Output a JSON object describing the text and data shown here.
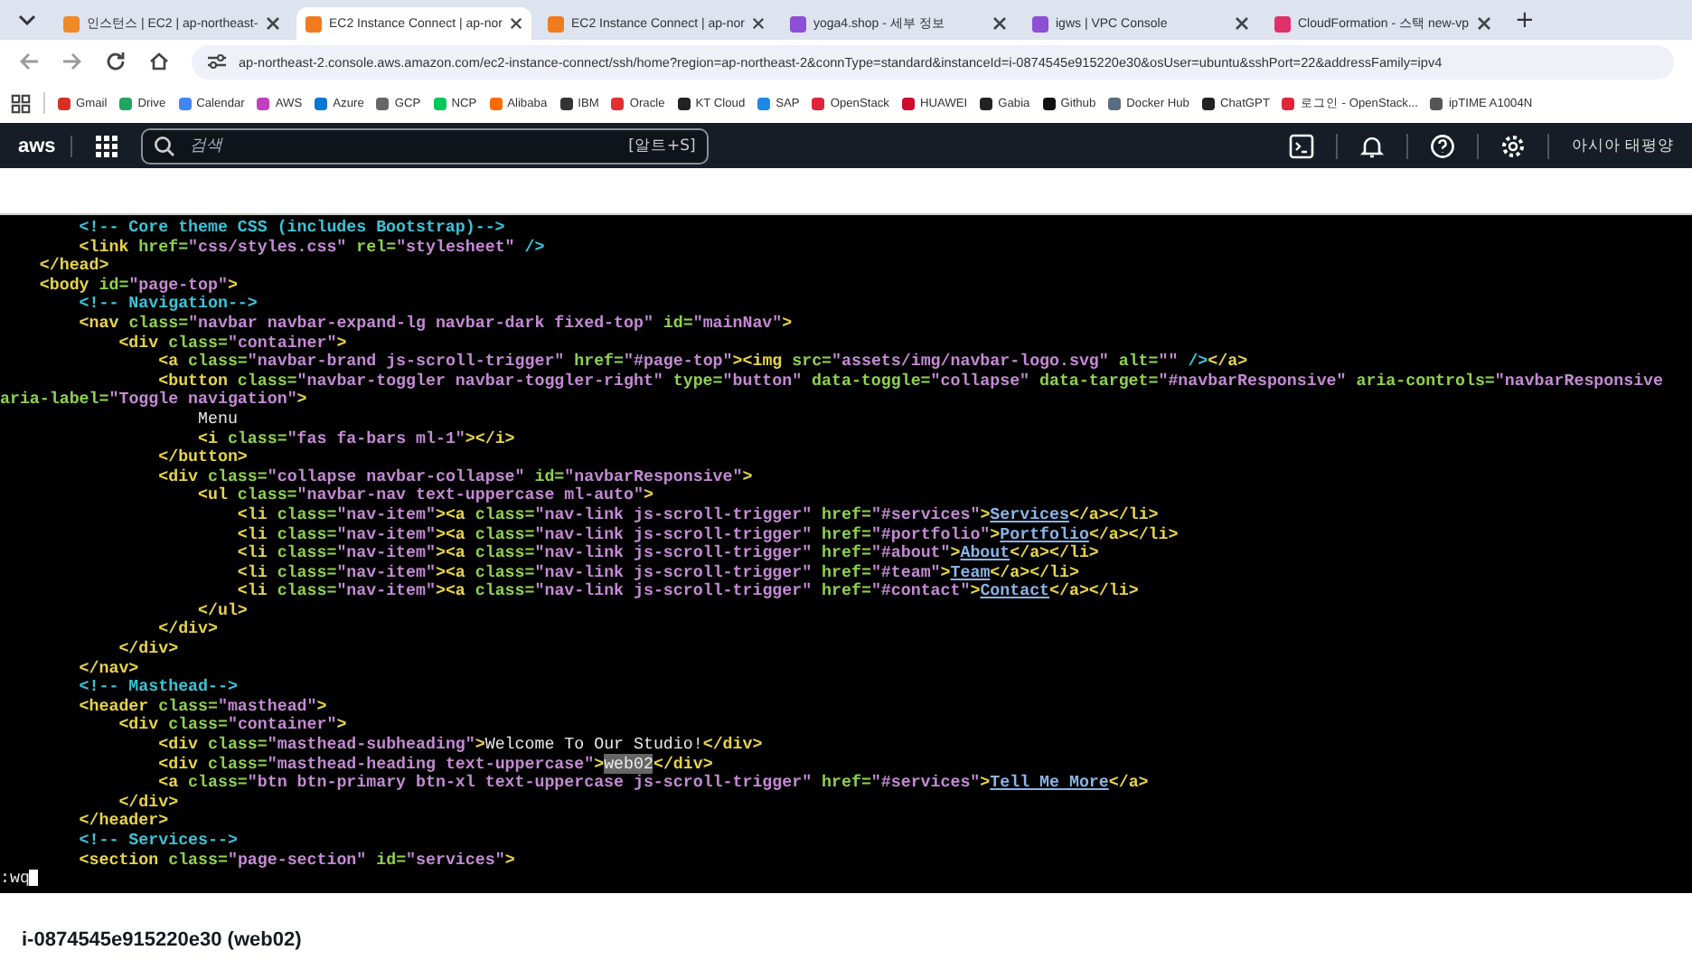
{
  "browser": {
    "tabs": [
      {
        "title": "인스턴스 | EC2 | ap-northeast-",
        "selected": false,
        "color": "#f08a24"
      },
      {
        "title": "EC2 Instance Connect | ap-nor",
        "selected": true,
        "color": "#f07b1e"
      },
      {
        "title": "EC2 Instance Connect | ap-nor",
        "selected": false,
        "color": "#f07b1e"
      },
      {
        "title": "yoga4.shop - 세부 정보",
        "selected": false,
        "color": "#8c4fd6"
      },
      {
        "title": "igws | VPC Console",
        "selected": false,
        "color": "#8c4fd6"
      },
      {
        "title": "CloudFormation - 스택 new-vp",
        "selected": false,
        "color": "#e0306a"
      }
    ],
    "new_tab": "+",
    "url": "ap-northeast-2.console.aws.amazon.com/ec2-instance-connect/ssh/home?region=ap-northeast-2&connType=standard&instanceId=i-0874545e915220e30&osUser=ubuntu&sshPort=22&addressFamily=ipv4",
    "bookmarks": [
      {
        "label": "Gmail",
        "color": "#d93025"
      },
      {
        "label": "Drive",
        "color": "#1fa463"
      },
      {
        "label": "Calendar",
        "color": "#4285f4"
      },
      {
        "label": "AWS",
        "color": "#c040c0"
      },
      {
        "label": "Azure",
        "color": "#0078d4"
      },
      {
        "label": "GCP",
        "color": "#666666"
      },
      {
        "label": "NCP",
        "color": "#03c75a"
      },
      {
        "label": "Alibaba",
        "color": "#ff6a00"
      },
      {
        "label": "IBM",
        "color": "#333333"
      },
      {
        "label": "Oracle",
        "color": "#e03030"
      },
      {
        "label": "KT Cloud",
        "color": "#222222"
      },
      {
        "label": "SAP",
        "color": "#1e88e5"
      },
      {
        "label": "OpenStack",
        "color": "#e0263a"
      },
      {
        "label": "HUAWEI",
        "color": "#cf0a2c"
      },
      {
        "label": "Gabia",
        "color": "#222222"
      },
      {
        "label": "Github",
        "color": "#111111"
      },
      {
        "label": "Docker Hub",
        "color": "#5a6d80"
      },
      {
        "label": "ChatGPT",
        "color": "#222222"
      },
      {
        "label": "로그인 - OpenStack...",
        "color": "#e0263a"
      },
      {
        "label": "ipTIME A1004N",
        "color": "#555555"
      }
    ]
  },
  "console_header": {
    "logo": "aws",
    "search": {
      "placeholder": "검색",
      "shortcut": "[알트+S]"
    },
    "region": "아시아 태평양"
  },
  "terminal": {
    "lines": [
      [
        {
          "kind": "com",
          "text": "        <!-- Core theme CSS (includes Bootstrap)-->"
        }
      ],
      [
        {
          "kind": "tag",
          "text": "        <link"
        },
        {
          "kind": "attr",
          "text": " href="
        },
        {
          "kind": "val",
          "text": "\"css/styles.css\""
        },
        {
          "kind": "attr",
          "text": " rel="
        },
        {
          "kind": "val",
          "text": "\"stylesheet\""
        },
        {
          "kind": "com",
          "text": " />"
        }
      ],
      [
        {
          "kind": "tag",
          "text": "    </head>"
        }
      ],
      [
        {
          "kind": "tag",
          "text": "    <body"
        },
        {
          "kind": "attr",
          "text": " id="
        },
        {
          "kind": "val",
          "text": "\"page-top\""
        },
        {
          "kind": "tag",
          "text": ">"
        }
      ],
      [
        {
          "kind": "com",
          "text": "        <!-- Navigation-->"
        }
      ],
      [
        {
          "kind": "tag",
          "text": "        <nav"
        },
        {
          "kind": "attr",
          "text": " class="
        },
        {
          "kind": "val",
          "text": "\"navbar navbar-expand-lg navbar-dark fixed-top\""
        },
        {
          "kind": "attr",
          "text": " id="
        },
        {
          "kind": "val",
          "text": "\"mainNav\""
        },
        {
          "kind": "tag",
          "text": ">"
        }
      ],
      [
        {
          "kind": "tag",
          "text": "            <div"
        },
        {
          "kind": "attr",
          "text": " class="
        },
        {
          "kind": "val",
          "text": "\"container\""
        },
        {
          "kind": "tag",
          "text": ">"
        }
      ],
      [
        {
          "kind": "tag",
          "text": "                <a"
        },
        {
          "kind": "attr",
          "text": " class="
        },
        {
          "kind": "val",
          "text": "\"navbar-brand js-scroll-trigger\""
        },
        {
          "kind": "attr",
          "text": " href="
        },
        {
          "kind": "val",
          "text": "\"#page-top\""
        },
        {
          "kind": "tag",
          "text": "><img"
        },
        {
          "kind": "attr",
          "text": " src="
        },
        {
          "kind": "val",
          "text": "\"assets/img/navbar-logo.svg\""
        },
        {
          "kind": "attr",
          "text": " alt="
        },
        {
          "kind": "val",
          "text": "\"\""
        },
        {
          "kind": "com",
          "text": " />"
        },
        {
          "kind": "tag",
          "text": "</a>"
        }
      ],
      [
        {
          "kind": "tag",
          "text": "                <button"
        },
        {
          "kind": "attr",
          "text": " class="
        },
        {
          "kind": "val",
          "text": "\"navbar-toggler navbar-toggler-right\""
        },
        {
          "kind": "attr",
          "text": " type="
        },
        {
          "kind": "val",
          "text": "\"button\""
        },
        {
          "kind": "attr",
          "text": " data-toggle="
        },
        {
          "kind": "val",
          "text": "\"collapse\""
        },
        {
          "kind": "attr",
          "text": " data-target="
        },
        {
          "kind": "val",
          "text": "\"#navbarResponsive\""
        },
        {
          "kind": "attr",
          "text": " aria-controls="
        },
        {
          "kind": "val",
          "text": "\"navbarResponsive"
        }
      ],
      [
        {
          "kind": "attr",
          "text": "aria-label="
        },
        {
          "kind": "val",
          "text": "\"Toggle navigation\""
        },
        {
          "kind": "tag",
          "text": ">"
        }
      ],
      [
        {
          "kind": "txt",
          "text": "                    Menu"
        }
      ],
      [
        {
          "kind": "tag",
          "text": "                    <i"
        },
        {
          "kind": "attr",
          "text": " class="
        },
        {
          "kind": "val",
          "text": "\"fas fa-bars ml-1\""
        },
        {
          "kind": "tag",
          "text": "></i>"
        }
      ],
      [
        {
          "kind": "tag",
          "text": "                </button>"
        }
      ],
      [
        {
          "kind": "tag",
          "text": "                <div"
        },
        {
          "kind": "attr",
          "text": " class="
        },
        {
          "kind": "val",
          "text": "\"collapse navbar-collapse\""
        },
        {
          "kind": "attr",
          "text": " id="
        },
        {
          "kind": "val",
          "text": "\"navbarResponsive\""
        },
        {
          "kind": "tag",
          "text": ">"
        }
      ],
      [
        {
          "kind": "tag",
          "text": "                    <ul"
        },
        {
          "kind": "attr",
          "text": " class="
        },
        {
          "kind": "val",
          "text": "\"navbar-nav text-uppercase ml-auto\""
        },
        {
          "kind": "tag",
          "text": ">"
        }
      ],
      [
        {
          "kind": "tag",
          "text": "                        <li"
        },
        {
          "kind": "attr",
          "text": " class="
        },
        {
          "kind": "val",
          "text": "\"nav-item\""
        },
        {
          "kind": "tag",
          "text": "><a"
        },
        {
          "kind": "attr",
          "text": " class="
        },
        {
          "kind": "val",
          "text": "\"nav-link js-scroll-trigger\""
        },
        {
          "kind": "attr",
          "text": " href="
        },
        {
          "kind": "val",
          "text": "\"#services\""
        },
        {
          "kind": "tag",
          "text": ">"
        },
        {
          "kind": "link",
          "text": "Services"
        },
        {
          "kind": "tag",
          "text": "</a></li>"
        }
      ],
      [
        {
          "kind": "tag",
          "text": "                        <li"
        },
        {
          "kind": "attr",
          "text": " class="
        },
        {
          "kind": "val",
          "text": "\"nav-item\""
        },
        {
          "kind": "tag",
          "text": "><a"
        },
        {
          "kind": "attr",
          "text": " class="
        },
        {
          "kind": "val",
          "text": "\"nav-link js-scroll-trigger\""
        },
        {
          "kind": "attr",
          "text": " href="
        },
        {
          "kind": "val",
          "text": "\"#portfolio\""
        },
        {
          "kind": "tag",
          "text": ">"
        },
        {
          "kind": "link",
          "text": "Portfolio"
        },
        {
          "kind": "tag",
          "text": "</a></li>"
        }
      ],
      [
        {
          "kind": "tag",
          "text": "                        <li"
        },
        {
          "kind": "attr",
          "text": " class="
        },
        {
          "kind": "val",
          "text": "\"nav-item\""
        },
        {
          "kind": "tag",
          "text": "><a"
        },
        {
          "kind": "attr",
          "text": " class="
        },
        {
          "kind": "val",
          "text": "\"nav-link js-scroll-trigger\""
        },
        {
          "kind": "attr",
          "text": " href="
        },
        {
          "kind": "val",
          "text": "\"#about\""
        },
        {
          "kind": "tag",
          "text": ">"
        },
        {
          "kind": "link",
          "text": "About"
        },
        {
          "kind": "tag",
          "text": "</a></li>"
        }
      ],
      [
        {
          "kind": "tag",
          "text": "                        <li"
        },
        {
          "kind": "attr",
          "text": " class="
        },
        {
          "kind": "val",
          "text": "\"nav-item\""
        },
        {
          "kind": "tag",
          "text": "><a"
        },
        {
          "kind": "attr",
          "text": " class="
        },
        {
          "kind": "val",
          "text": "\"nav-link js-scroll-trigger\""
        },
        {
          "kind": "attr",
          "text": " href="
        },
        {
          "kind": "val",
          "text": "\"#team\""
        },
        {
          "kind": "tag",
          "text": ">"
        },
        {
          "kind": "link",
          "text": "Team"
        },
        {
          "kind": "tag",
          "text": "</a></li>"
        }
      ],
      [
        {
          "kind": "tag",
          "text": "                        <li"
        },
        {
          "kind": "attr",
          "text": " class="
        },
        {
          "kind": "val",
          "text": "\"nav-item\""
        },
        {
          "kind": "tag",
          "text": "><a"
        },
        {
          "kind": "attr",
          "text": " class="
        },
        {
          "kind": "val",
          "text": "\"nav-link js-scroll-trigger\""
        },
        {
          "kind": "attr",
          "text": " href="
        },
        {
          "kind": "val",
          "text": "\"#contact\""
        },
        {
          "kind": "tag",
          "text": ">"
        },
        {
          "kind": "link",
          "text": "Contact"
        },
        {
          "kind": "tag",
          "text": "</a></li>"
        }
      ],
      [
        {
          "kind": "tag",
          "text": "                    </ul>"
        }
      ],
      [
        {
          "kind": "tag",
          "text": "                </div>"
        }
      ],
      [
        {
          "kind": "tag",
          "text": "            </div>"
        }
      ],
      [
        {
          "kind": "tag",
          "text": "        </nav>"
        }
      ],
      [
        {
          "kind": "com",
          "text": "        <!-- Masthead-->"
        }
      ],
      [
        {
          "kind": "tag",
          "text": "        <header"
        },
        {
          "kind": "attr",
          "text": " class="
        },
        {
          "kind": "val",
          "text": "\"masthead\""
        },
        {
          "kind": "tag",
          "text": ">"
        }
      ],
      [
        {
          "kind": "tag",
          "text": "            <div"
        },
        {
          "kind": "attr",
          "text": " class="
        },
        {
          "kind": "val",
          "text": "\"container\""
        },
        {
          "kind": "tag",
          "text": ">"
        }
      ],
      [
        {
          "kind": "tag",
          "text": "                <div"
        },
        {
          "kind": "attr",
          "text": " class="
        },
        {
          "kind": "val",
          "text": "\"masthead-subheading\""
        },
        {
          "kind": "tag",
          "text": ">"
        },
        {
          "kind": "txt",
          "text": "Welcome To Our Studio!"
        },
        {
          "kind": "tag",
          "text": "</div>"
        }
      ],
      [
        {
          "kind": "tag",
          "text": "                <div"
        },
        {
          "kind": "attr",
          "text": " class="
        },
        {
          "kind": "val",
          "text": "\"masthead-heading text-uppercase\""
        },
        {
          "kind": "tag",
          "text": ">"
        },
        {
          "kind": "sel",
          "text": "web02"
        },
        {
          "kind": "tag",
          "text": "</div>"
        }
      ],
      [
        {
          "kind": "tag",
          "text": "                <a"
        },
        {
          "kind": "attr",
          "text": " class="
        },
        {
          "kind": "val",
          "text": "\"btn btn-primary btn-xl text-uppercase js-scroll-trigger\""
        },
        {
          "kind": "attr",
          "text": " href="
        },
        {
          "kind": "val",
          "text": "\"#services\""
        },
        {
          "kind": "tag",
          "text": ">"
        },
        {
          "kind": "link",
          "text": "Tell Me More"
        },
        {
          "kind": "tag",
          "text": "</a>"
        }
      ],
      [
        {
          "kind": "tag",
          "text": "            </div>"
        }
      ],
      [
        {
          "kind": "tag",
          "text": "        </header>"
        }
      ],
      [
        {
          "kind": "com",
          "text": "        <!-- Services-->"
        }
      ],
      [
        {
          "kind": "tag",
          "text": "        <section"
        },
        {
          "kind": "attr",
          "text": " class="
        },
        {
          "kind": "val",
          "text": "\"page-section\""
        },
        {
          "kind": "attr",
          "text": " id="
        },
        {
          "kind": "val",
          "text": "\"services\""
        },
        {
          "kind": "tag",
          "text": ">"
        }
      ]
    ],
    "command": ":wq"
  },
  "instance_title": "i-0874545e915220e30 (web02)"
}
